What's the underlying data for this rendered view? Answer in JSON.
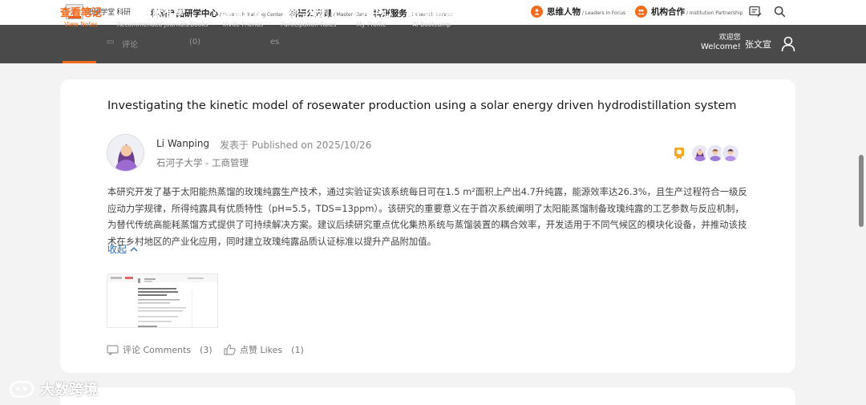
{
  "brand": {
    "logo_text": "思维学堂 科研",
    "accent": "#f26a1b"
  },
  "top_links": [
    {
      "cn": "科研产品研学中心",
      "en": "/ Research Training Center"
    },
    {
      "cn": "科研公开课",
      "en": "/ Master Class"
    },
    {
      "cn": "科研服务",
      "en": "/ Research Service"
    }
  ],
  "top_right": [
    {
      "cn": "思维人物",
      "en": "/ Leaders in Focus"
    },
    {
      "cn": "机构合作",
      "en": "/ Institution Partnership"
    }
  ],
  "nav": [
    {
      "cn": "查看笔记",
      "en": "View Notes",
      "active": true
    },
    {
      "cn": "文献推荐",
      "en": "Recommended Journals/Books"
    },
    {
      "cn": "邀请好友",
      "en": "Invite Friends"
    },
    {
      "cn": "参与规则",
      "en": "Participation Rules"
    },
    {
      "cn": "个人中心",
      "en": "My Profile"
    },
    {
      "cn": "AI 训练营",
      "en": "AI Bootcamp"
    }
  ],
  "nav_ghost": {
    "a": "评论",
    "b": "(0)",
    "c": "es"
  },
  "user": {
    "welcome_cn": "欢迎您",
    "welcome_en": "Welcome!",
    "name": "张文宣"
  },
  "post": {
    "title": "Investigating the kinetic model of rosewater production using a solar energy driven hydrodistillation system",
    "author": "Li Wanping",
    "published": "发表于 Published on 2025/10/26",
    "affiliation": "石河子大学 - 工商管理",
    "abstract": "本研究开发了基于太阳能热蒸馏的玫瑰纯露生产技术，通过实验证实该系统每日可在1.5 m²面积上产出4.7升纯露，能源效率达26.3%，且生产过程符合一级反应动力学规律，所得纯露具有优质特性（pH=5.5，TDS=13ppm）。该研究的重要意义在于首次系统阐明了太阳能蒸馏制备玫瑰纯露的工艺参数与反应机制，为替代传统高能耗蒸馏方式提供了可持续解决方案。建议后续研究重点优化集热系统与蒸馏装置的耦合效率，开发适用于不同气候区的模块化设备，并推动该技术在乡村地区的产业化应用，同时建立玫瑰纯露品质认证标准以提升产品附加值。",
    "collapse_label": "收起",
    "comments_label": "评论 Comments",
    "comments_count": "(3)",
    "likes_label": "点赞 Likes",
    "likes_count": "(1)"
  },
  "watermark": "大数跨境"
}
